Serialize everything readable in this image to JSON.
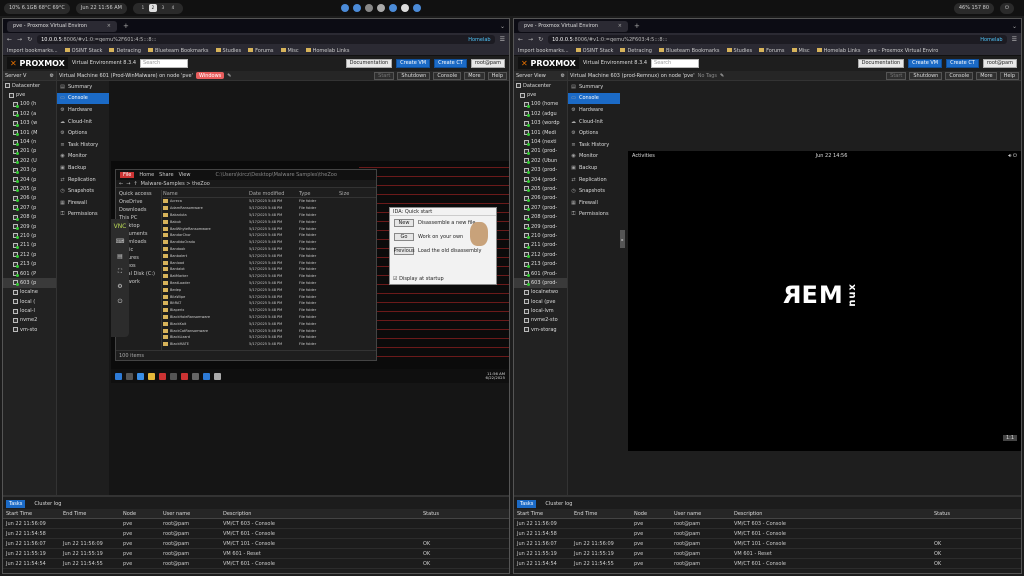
{
  "topbar": {
    "sysinfo": "10% 6.1GB 68°C 69°C",
    "datetime": "Jun 22 11:56 AM",
    "workspaces": [
      "1",
      "2",
      "3",
      "4"
    ],
    "active_ws": "2",
    "right": "46% 157 80"
  },
  "left": {
    "tab": "pve - Proxmox Virtual Environ",
    "url_host": "10.0.0.5",
    "url_rest": ":8006/#v1:0:=qemu%2F601:4:5:::8:::",
    "homelab": "Homelab",
    "bookmarks": [
      "Import bookmarks...",
      "OSINT Stack",
      "Detracing",
      "Blueteam Bookmarks",
      "Studies",
      "Forums",
      "Misc",
      "Homelab Links"
    ],
    "brand": "PROXMOX",
    "version": "Virtual Environment 8.3.4",
    "search": "Search",
    "docs": "Documentation",
    "create_vm": "Create VM",
    "create_ct": "Create CT",
    "user": "root@pam",
    "server_view": "Server V",
    "vm_title": "Virtual Machine 601 (Prod-WinMalware) on node 'pve'",
    "vm_tag": "Windows",
    "toolbar": [
      "Start",
      "Shutdown",
      "Console",
      "More",
      "Help"
    ],
    "tree": [
      "Datacenter",
      "pve",
      "100 (h",
      "102 (a",
      "103 (w",
      "101 (M",
      "104 (n",
      "201 (p",
      "202 (U",
      "203 (p",
      "204 (p",
      "205 (p",
      "206 (p",
      "207 (p",
      "208 (p",
      "209 (p",
      "210 (p",
      "211 (p",
      "212 (p",
      "213 (p",
      "601 (P",
      "603 (p",
      "localne",
      "local (",
      "local-l",
      "nvme2",
      "vm-sto"
    ],
    "menu": [
      "Summary",
      "Console",
      "Hardware",
      "Cloud-Init",
      "Options",
      "Task History",
      "Monitor",
      "Backup",
      "Replication",
      "Snapshots",
      "Firewall",
      "Permissions"
    ],
    "win": {
      "path": "C:\\Users\\kircz\\Desktop\\Malware Samples\\theZoo",
      "crumb": "Malware-Samples > theZoo",
      "tabs": [
        "File",
        "Home",
        "Share",
        "View"
      ],
      "nav": [
        "Quick access",
        "OneDrive",
        "Downloads",
        "This PC",
        "Desktop",
        "Documents",
        "Downloads",
        "Music",
        "Pictures",
        "Videos",
        "Local Disk (C:)",
        "Network"
      ],
      "cols": [
        "Name",
        "Date modified",
        "Type",
        "Size"
      ],
      "files": [
        "Acreca",
        "AdamRansomware",
        "Bakaduta",
        "Babuk",
        "BadWhyteRansomware",
        "BandarChor",
        "BandidoOrado",
        "Bandook",
        "Banbalert",
        "Banload",
        "Bantalot",
        "BatMarker",
        "BeatLoader",
        "Bedep",
        "BilaWipe",
        "BitRAT",
        "Blaperix",
        "BlackHoleRansomware",
        "BlackKait",
        "BlackCatRansomware",
        "BlackLizard",
        "BlackMATE"
      ],
      "date": "5/17/2025 5:48 PM",
      "type": "File folder",
      "items": "100 items",
      "dialog_title": "IDA: Quick start",
      "d_new": "New",
      "d_new_t": "Disassemble a new file",
      "d_go": "Go",
      "d_go_t": "Work on your own",
      "d_prev": "Previous",
      "d_prev_t": "Load the old disassembly",
      "d_foot": "Display at startup",
      "vnc": "VNC",
      "time": "11:56 AM",
      "tdate": "6/22/2025"
    },
    "tasks": {
      "tab1": "Tasks",
      "tab2": "Cluster log",
      "cols": [
        "Start Time",
        "End Time",
        "Node",
        "User name",
        "Description",
        "Status"
      ],
      "rows": [
        [
          "Jun 22 11:56:09",
          "",
          "pve",
          "root@pam",
          "VM/CT 603 - Console",
          ""
        ],
        [
          "Jun 22 11:54:58",
          "",
          "pve",
          "root@pam",
          "VM/CT 601 - Console",
          ""
        ],
        [
          "Jun 22 11:56:07",
          "Jun 22 11:56:09",
          "pve",
          "root@pam",
          "VM/CT 101 - Console",
          "OK"
        ],
        [
          "Jun 22 11:55:19",
          "Jun 22 11:55:19",
          "pve",
          "root@pam",
          "VM 601 - Reset",
          "OK"
        ],
        [
          "Jun 22 11:54:54",
          "Jun 22 11:54:55",
          "pve",
          "root@pam",
          "VM/CT 601 - Console",
          "OK"
        ]
      ]
    }
  },
  "right": {
    "tab": "pve - Proxmox Virtual Environ",
    "url_host": "10.0.0.5",
    "url_rest": ":8006/#v1:0:=qemu%2F603:4:5:::8:::",
    "homelab": "Homelab",
    "bookmarks": [
      "Import bookmarks...",
      "OSINT Stack",
      "Detracing",
      "Blueteam Bookmarks",
      "Studies",
      "Forums",
      "Misc",
      "Homelab Links",
      "pve - Proxmox Virtual Enviro"
    ],
    "brand": "PROXMOX",
    "version": "Virtual Environment 8.3.4",
    "search": "Search",
    "docs": "Documentation",
    "create_vm": "Create VM",
    "create_ct": "Create CT",
    "user": "root@pam",
    "server_view": "Server View",
    "vm_title": "Virtual Machine 603 (prod-Remnux) on node 'pve'",
    "vm_tag": "No Tags",
    "toolbar": [
      "Start",
      "Shutdown",
      "Console",
      "More",
      "Help"
    ],
    "tree": [
      "Datacenter",
      "pve",
      "100 (home",
      "102 (adgu",
      "103 (wordp",
      "101 (Medi",
      "104 (nexti",
      "201 (prod-",
      "202 (Ubun",
      "203 (prod-",
      "204 (prod-",
      "205 (prod-",
      "206 (prod-",
      "207 (prod-",
      "208 (prod-",
      "209 (prod-",
      "210 (prod-",
      "211 (prod-",
      "212 (prod-",
      "213 (prod-",
      "601 (Prod-",
      "603 (prod-",
      "localnetwo",
      "local (pve",
      "local-lvm",
      "nvme2-sto",
      "vm-storag"
    ],
    "menu": [
      "Summary",
      "Console",
      "Hardware",
      "Cloud-Init",
      "Options",
      "Task History",
      "Monitor",
      "Backup",
      "Replication",
      "Snapshots",
      "Firewall",
      "Permissions"
    ],
    "guest": {
      "activities": "Activities",
      "clock": "Jun 22  14:56",
      "logo": "REM",
      "logo2": "nux",
      "scale": "1:1"
    },
    "tasks": {
      "tab1": "Tasks",
      "tab2": "Cluster log",
      "cols": [
        "Start Time",
        "End Time",
        "Node",
        "User name",
        "Description",
        "Status"
      ],
      "rows": [
        [
          "Jun 22 11:56:09",
          "",
          "pve",
          "root@pam",
          "VM/CT 603 - Console",
          ""
        ],
        [
          "Jun 22 11:54:58",
          "",
          "pve",
          "root@pam",
          "VM/CT 601 - Console",
          ""
        ],
        [
          "Jun 22 11:56:07",
          "Jun 22 11:56:09",
          "pve",
          "root@pam",
          "VM/CT 101 - Console",
          "OK"
        ],
        [
          "Jun 22 11:55:19",
          "Jun 22 11:55:19",
          "pve",
          "root@pam",
          "VM 601 - Reset",
          "OK"
        ],
        [
          "Jun 22 11:54:54",
          "Jun 22 11:54:55",
          "pve",
          "root@pam",
          "VM/CT 601 - Console",
          "OK"
        ]
      ]
    }
  }
}
